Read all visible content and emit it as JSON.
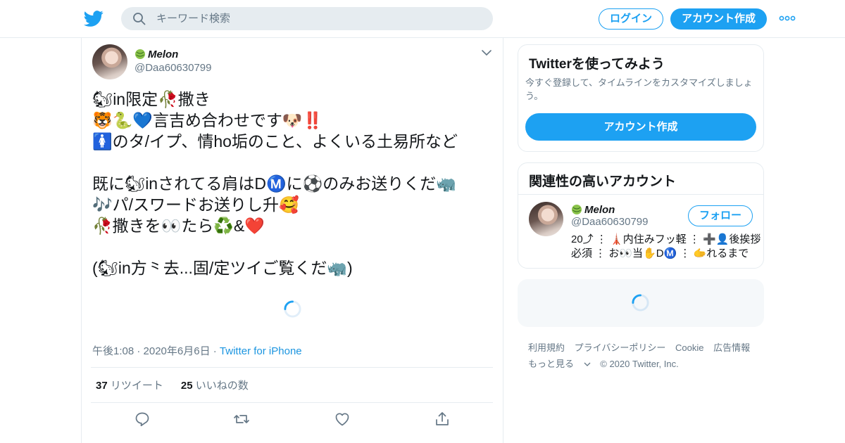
{
  "header": {
    "search_placeholder": "キーワード検索",
    "login_label": "ログイン",
    "signup_label": "アカウント作成"
  },
  "tweet": {
    "display_name": "Melon",
    "handle": "@Daa60630799",
    "text": "🐿in限定🥀撒き\n🐯🐍💙言吉め合わせです🐶‼️\n🚺のタ/イプ、情ho垢のこと、よくいる土易所など\n\n既に🐿inされてる肩はDⓂ️に⚽のみお送りくだ🦏\n🎶パ/スワードお送りし升🥰\n🥀撒きを👀たら♻️&❤️\n\n(🐿in方⺀去...固/定ツイご覧くだ🦏)",
    "timestamp": "午後1:08 · 2020年6月6日 · ",
    "source": "Twitter for iPhone",
    "retweet_count": "37",
    "retweet_label": "リツイート",
    "like_count": "25",
    "like_label": "いいねの数"
  },
  "sidebar": {
    "signup_card": {
      "title": "Twitterを使ってみよう",
      "description": "今すぐ登録して、タイムラインをカスタマイズしましょう。",
      "cta_label": "アカウント作成"
    },
    "related": {
      "title": "関連性の高いアカウント",
      "display_name": "Melon",
      "handle": "@Daa60630799",
      "follow_label": "フォロー",
      "bio": "20⤴︎ ⋮ 🗼内住みフッ軽 ⋮ ➕👤後挨拶\n必須 ⋮ お👀当✋DⓂ️ ⋮ 🫱れるまで"
    }
  },
  "footer": {
    "links": [
      "利用規約",
      "プライバシーポリシー",
      "Cookie",
      "広告情報"
    ],
    "more_label": "もっと見る",
    "copyright": "© 2020 Twitter, Inc."
  },
  "colors": {
    "accent": "#1da1f2",
    "link": "#1b95e0",
    "secondary_text": "#657786",
    "border": "#e6ecf0"
  },
  "icons": [
    "twitter-bird-icon",
    "search-icon",
    "more-dots-icon",
    "melon-icon",
    "chevron-down-icon",
    "reply-icon",
    "retweet-icon",
    "like-icon",
    "share-icon",
    "loading-spinner-icon"
  ]
}
